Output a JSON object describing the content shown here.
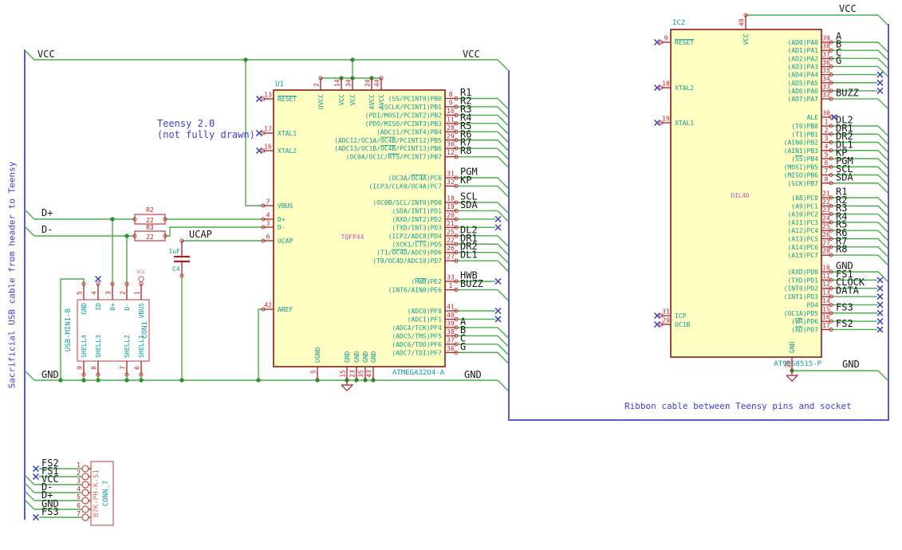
{
  "app": {
    "type": "schematic-capture-sheet"
  },
  "colors": {
    "wire": "#4aae4a",
    "bus": "#5a5acd",
    "pin": "#a82020",
    "ic_border": "#8c1a1a",
    "ic_fill": "#ffffc2",
    "pin_name": "#0d9b9b",
    "pin_number": "#c22020",
    "reference": "#0d9b9b",
    "field_pink": "#c050c0",
    "net_label": "#161616",
    "comment": "#3c3cdd",
    "no_connect": "#3b3bc0",
    "junction": "#2f9432",
    "connector_border": "#d07575",
    "power_pink": "#d06a6a"
  },
  "notes": {
    "teensy_line1": "Teensy 2.0",
    "teensy_line2": "(not fully drawn)",
    "ribbon": "Ribbon cable between Teensy pins and socket",
    "sacrificial": "Sacrificial USB cable from header to Teensy"
  },
  "power_labels": {
    "vcc": "VCC",
    "gnd": "GND",
    "ucap": "UCAP",
    "dplus": "D+",
    "dminus": "D-"
  },
  "u1": {
    "ref": "U1",
    "part": "ATMEGA32U4-A",
    "package": "TQFP44",
    "top_pins": [
      [
        "2",
        "UVCC"
      ],
      [
        "14",
        "VCC"
      ],
      [
        "34",
        "VCC"
      ],
      [
        "24",
        "AVCC"
      ],
      [
        "44",
        "AVCC"
      ]
    ],
    "bottom_pins": [
      [
        "5",
        "UGND"
      ],
      [
        "15",
        "GND"
      ],
      [
        "23",
        "GND"
      ],
      [
        "35",
        "GND"
      ],
      [
        "43",
        "GND"
      ]
    ],
    "left_pins": [
      [
        "13",
        "{RESET}",
        "nc"
      ],
      [
        "17",
        "XTAL1",
        "nc"
      ],
      [
        "16",
        "XTAL2",
        "nc"
      ],
      [
        "7",
        "VBUS",
        "wire"
      ],
      [
        "4",
        "D+",
        "wire"
      ],
      [
        "3",
        "D-",
        "wire"
      ],
      [
        "6",
        "UCAP",
        "wire"
      ],
      [
        "42",
        "AREF",
        "wire"
      ]
    ],
    "right_pins": [
      [
        "8",
        "(SS/PCINT0)PB0",
        "R1",
        "bus"
      ],
      [
        "9",
        "(SCLK/PCINT1)PB1",
        "R2",
        "bus"
      ],
      [
        "10",
        "(PDI/MOSI/PCINT2)PB2",
        "R3",
        "bus"
      ],
      [
        "11",
        "(PDO/MISO/PCINT3)PB3",
        "R4",
        "bus"
      ],
      [
        "28",
        "(ADC11/PCINT4)PB4",
        "R5",
        "bus"
      ],
      [
        "29",
        "(ADC12/OC1A/{OC4B}/PCINT12)PB5",
        "R6",
        "bus"
      ],
      [
        "30",
        "(ADC13/OC1B/{OC4B}/PCINT13)PB6",
        "R7",
        "bus"
      ],
      [
        "12",
        "(OC0A/OC1C/{RTS}/PCINT7)PB7",
        "R8",
        "bus"
      ],
      [
        "31",
        "(OC3A/{OC4A})PC6",
        "PGM",
        "bus"
      ],
      [
        "32",
        "(ICP3/CLK0/OC4A)PC7",
        "KP",
        "bus"
      ],
      [
        "18",
        "(OC0B/SCL/INT0)PD0",
        "SCL",
        "bus"
      ],
      [
        "19",
        "(SDA/INT1)PD1",
        "SDA",
        "bus"
      ],
      [
        "20",
        "(RXD/INT2)PD2",
        "",
        "nc"
      ],
      [
        "21",
        "(TXD/INT3)PD3",
        "",
        "nc"
      ],
      [
        "25",
        "(ICP2/ADC8)PD4",
        "DL2",
        "bus"
      ],
      [
        "22",
        "(XCK1/{CTS})PD5",
        "DR1",
        "bus"
      ],
      [
        "26",
        "(T1/{OC4D}/ADC9)PD6",
        "DR2",
        "bus"
      ],
      [
        "27",
        "(T0/OC4D/ADC10)PD7",
        "DL1",
        "bus"
      ],
      [
        "33",
        "({HWB})PE2",
        "HWB",
        "nc"
      ],
      [
        "1",
        "(INT6/AIN0)PE6",
        "BUZZ",
        "bus"
      ],
      [
        "41",
        "(ADC0)PF0",
        "",
        "nc"
      ],
      [
        "40",
        "(ADC1)PF1",
        "",
        "nc"
      ],
      [
        "39",
        "(ADC4/TCK)PF4",
        "A",
        "bus"
      ],
      [
        "38",
        "(ADC5/TMS)PF5",
        "B",
        "bus"
      ],
      [
        "37",
        "(ADC6/TDO)PF6",
        "C",
        "bus"
      ],
      [
        "36",
        "(ADC7/TDI)PF7",
        "G",
        "bus"
      ]
    ]
  },
  "ic2": {
    "ref": "IC2",
    "part": "AT90S8515-P",
    "package": "DIL40",
    "top_pins": [
      [
        "40",
        "VCC"
      ]
    ],
    "bottom_pins": [
      [
        "20",
        "GND"
      ]
    ],
    "left_pins": [
      [
        "9",
        "{RESET}"
      ],
      [
        "18",
        "XTAL2"
      ],
      [
        "19",
        "XTAL1"
      ],
      [
        "31",
        "ICP"
      ],
      [
        "29",
        "OC1B"
      ]
    ],
    "right_pins": [
      [
        "39",
        "(AD0)PA0",
        "A",
        "bus"
      ],
      [
        "38",
        "(AD1)PA1",
        "B",
        "bus"
      ],
      [
        "37",
        "(AD2)PA2",
        "C",
        "bus"
      ],
      [
        "36",
        "(AD3)PA3",
        "G",
        "bus"
      ],
      [
        "35",
        "(AD4)PA4",
        "",
        "nc"
      ],
      [
        "34",
        "(AD5)PA5",
        "",
        "nc"
      ],
      [
        "33",
        "(AD6)PA6",
        "",
        "nc"
      ],
      [
        "32",
        "(AD7)PA7",
        "BUZZ",
        "bus"
      ],
      [
        "30",
        "ALE",
        "",
        "ncpin"
      ],
      [
        "1",
        "(T0)PB0",
        "DL2",
        "bus"
      ],
      [
        "2",
        "(T1)PB1",
        "DR1",
        "bus"
      ],
      [
        "3",
        "(AIN0)PB2",
        "DR2",
        "bus"
      ],
      [
        "4",
        "(AIN1)PB3",
        "DL1",
        "bus"
      ],
      [
        "5",
        "({SS})PB4",
        "KP",
        "bus"
      ],
      [
        "6",
        "(MOSI)PB5",
        "PGM",
        "bus"
      ],
      [
        "7",
        "(MISO)PB6",
        "SCL",
        "bus"
      ],
      [
        "8",
        "(SCK)PB7",
        "SDA",
        "bus"
      ],
      [
        "21",
        "(A8)PC0",
        "R1",
        "bus"
      ],
      [
        "22",
        "(A9)PC1",
        "R2",
        "bus"
      ],
      [
        "23",
        "(A10)PC2",
        "R3",
        "bus"
      ],
      [
        "24",
        "(A11)PC3",
        "R4",
        "bus"
      ],
      [
        "25",
        "(A12)PC4",
        "R5",
        "bus"
      ],
      [
        "26",
        "(A13)PC5",
        "R6",
        "bus"
      ],
      [
        "27",
        "(A14)PC6",
        "R7",
        "bus"
      ],
      [
        "28",
        "(A15)PC7",
        "R8",
        "bus"
      ],
      [
        "10",
        "(RXD)PD0",
        "GND",
        "bus"
      ],
      [
        "11",
        "(TXD)PD1",
        "FS1",
        "nc"
      ],
      [
        "12",
        "(INT0)PD2",
        "CLOCK",
        "nc"
      ],
      [
        "13",
        "(INT1)PD3",
        "DATA",
        "nc"
      ],
      [
        "14",
        "PD4",
        "",
        "nc"
      ],
      [
        "15",
        "(OC1A)PD5",
        "FS3",
        "nc"
      ],
      [
        "16",
        "({WR})PD6",
        "",
        "nc"
      ],
      [
        "17",
        "({RD})PD7",
        "FS2",
        "nc"
      ]
    ]
  },
  "usb": {
    "ref": "CON1",
    "part": "USB-MINI-B",
    "top_pins": [
      [
        "5",
        "GND"
      ],
      [
        "4",
        "ID"
      ],
      [
        "3",
        "D+"
      ],
      [
        "2",
        "D-"
      ],
      [
        "1",
        "VBUS"
      ]
    ],
    "bottom_pins": [
      [
        "9",
        "SHELL4"
      ],
      [
        "8",
        "SHELL3"
      ],
      [
        "7",
        "SHELL2"
      ],
      [
        "6",
        "SHELL1"
      ]
    ]
  },
  "conn7": {
    "ref": "CONN_7",
    "part": "B7K-PH-K-S1",
    "pins": [
      [
        "1",
        "FS2",
        "nc"
      ],
      [
        "2",
        "FS1",
        "nc"
      ],
      [
        "3",
        "VCC",
        "bus"
      ],
      [
        "4",
        "D-",
        "bus"
      ],
      [
        "5",
        "D+",
        "bus"
      ],
      [
        "6",
        "GND",
        "bus"
      ],
      [
        "7",
        "FS3",
        "nc"
      ]
    ]
  },
  "r2": {
    "ref": "R2",
    "value": "22"
  },
  "r3": {
    "ref": "R3",
    "value": "22"
  },
  "c4": {
    "ref": "C4",
    "value": "1uF"
  },
  "vcc_symbol_label": "VCC"
}
